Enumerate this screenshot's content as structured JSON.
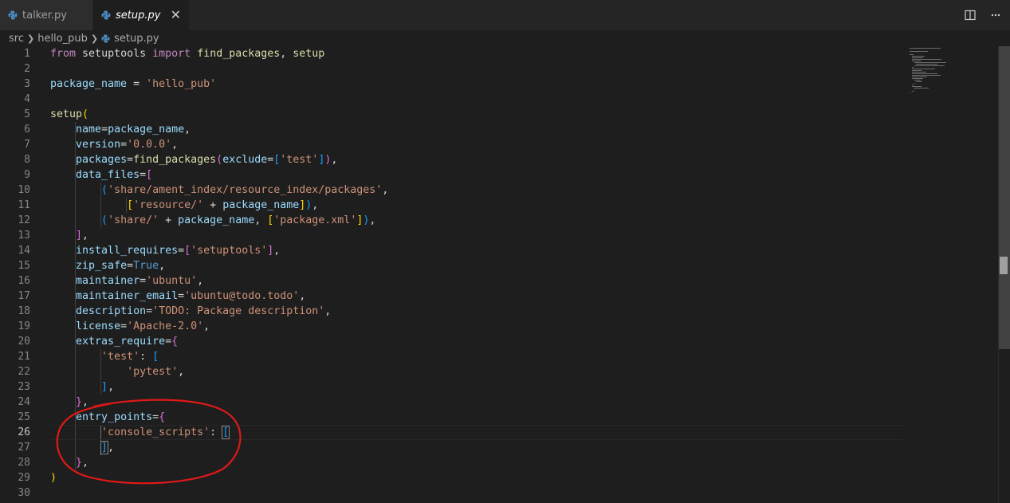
{
  "tabs": [
    {
      "label": "talker.py",
      "active": false
    },
    {
      "label": "setup.py",
      "active": true
    }
  ],
  "tab_close_glyph": "✕",
  "breadcrumb": [
    "src",
    "hello_pub",
    "setup.py"
  ],
  "editor": {
    "cursor_line": 26,
    "line_numbers": [
      "1",
      "2",
      "3",
      "4",
      "5",
      "6",
      "7",
      "8",
      "9",
      "10",
      "11",
      "12",
      "13",
      "14",
      "15",
      "16",
      "17",
      "18",
      "19",
      "20",
      "21",
      "22",
      "23",
      "24",
      "25",
      "26",
      "27",
      "28",
      "29",
      "30"
    ],
    "code_lines": [
      "from setuptools import find_packages, setup",
      "",
      "package_name = 'hello_pub'",
      "",
      "setup(",
      "    name=package_name,",
      "    version='0.0.0',",
      "    packages=find_packages(exclude=['test']),",
      "    data_files=[",
      "        ('share/ament_index/resource_index/packages',",
      "            ['resource/' + package_name]),",
      "        ('share/' + package_name, ['package.xml']),",
      "    ],",
      "    install_requires=['setuptools'],",
      "    zip_safe=True,",
      "    maintainer='ubuntu',",
      "    maintainer_email='ubuntu@todo.todo',",
      "    description='TODO: Package description',",
      "    license='Apache-2.0',",
      "    extras_require={",
      "        'test': [",
      "            'pytest',",
      "        ],",
      "    },",
      "    entry_points={",
      "        'console_scripts': [",
      "        ],",
      "    },",
      ")",
      ""
    ]
  },
  "icons": {
    "tab_file": "python-icon",
    "split": "split-editor-icon",
    "more": "more-actions-icon"
  },
  "colors": {
    "keyword": "#c586c0",
    "string": "#ce9178",
    "variable": "#9cdcfe",
    "function": "#dcdcaa",
    "annotation": "#e01818"
  }
}
